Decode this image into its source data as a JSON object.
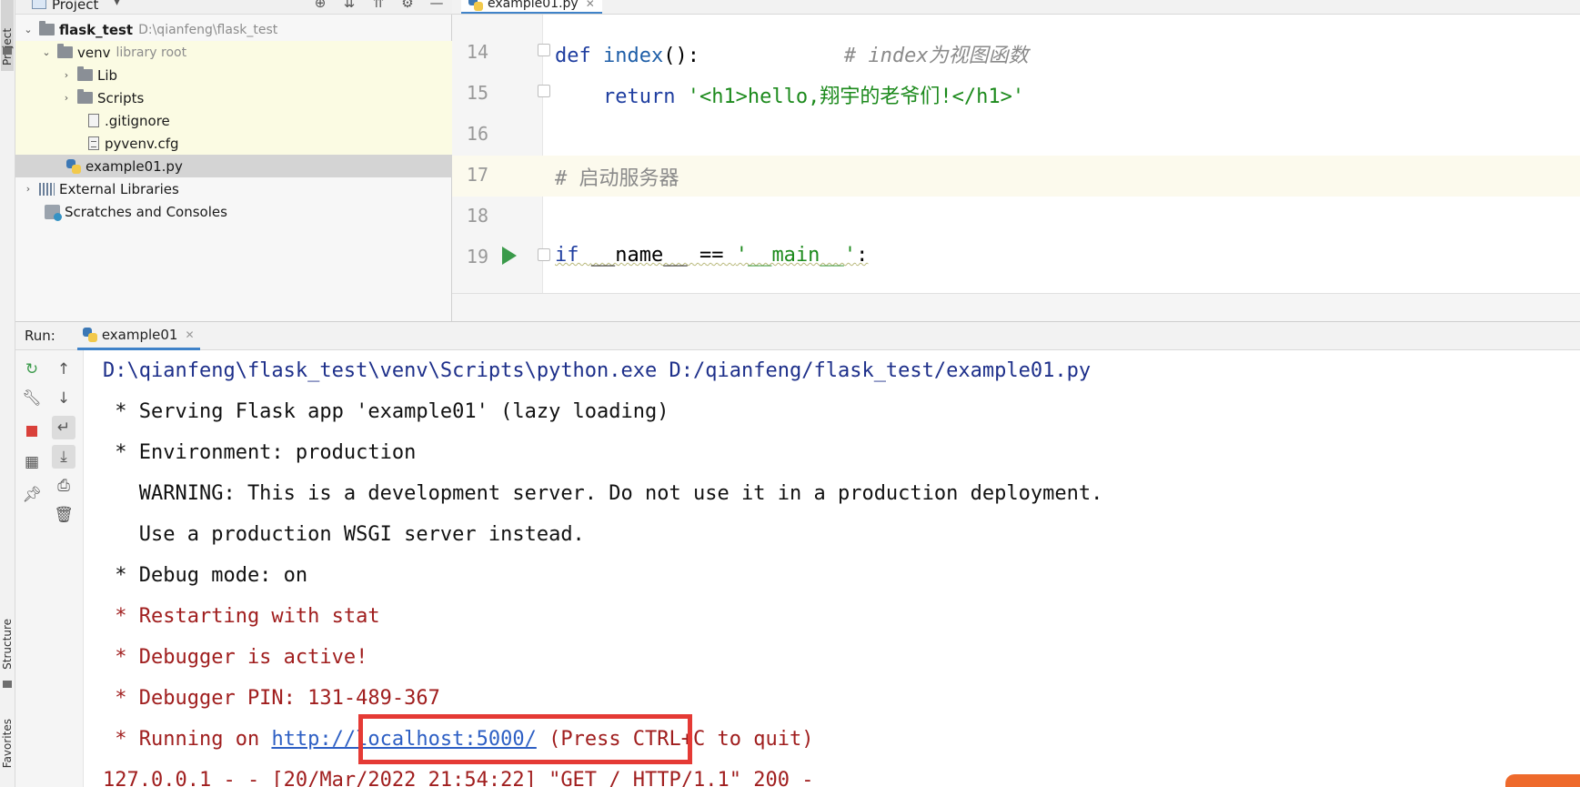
{
  "left_strip": {
    "project_tab": "Project",
    "structure_tab": "Structure",
    "favorites_tab": "Favorites"
  },
  "project": {
    "title": "Project",
    "tree": [
      {
        "label": "flask_test",
        "path": "D:\\qianfeng\\flask_test"
      },
      {
        "label": "venv",
        "note": "library root"
      },
      {
        "label": "Lib"
      },
      {
        "label": "Scripts"
      },
      {
        "label": ".gitignore"
      },
      {
        "label": "pyvenv.cfg"
      },
      {
        "label": "example01.py"
      },
      {
        "label": "External Libraries"
      },
      {
        "label": "Scratches and Consoles"
      }
    ]
  },
  "editor": {
    "tab": "example01.py",
    "lines": [
      {
        "no": "14",
        "kw": "def ",
        "fn": "index",
        "rest": "():",
        "comment": "# index为视图函数"
      },
      {
        "no": "15",
        "kw": "return ",
        "str": "'<h1>hello,翔宇的老爷们!</h1>'"
      },
      {
        "no": "16"
      },
      {
        "no": "17",
        "comment": "# 启动服务器"
      },
      {
        "no": "18"
      },
      {
        "no": "19",
        "kw": "if ",
        "mid": "__name__ == ",
        "str": "'__main__'",
        "end": ":"
      }
    ]
  },
  "run": {
    "label": "Run:",
    "tab": "example01",
    "console": {
      "cmd": "D:\\qianfeng\\flask_test\\venv\\Scripts\\python.exe D:/qianfeng/flask_test/example01.py",
      "l1": " * Serving Flask app 'example01' (lazy loading)",
      " l2": "",
      "l2": " * Environment: production",
      "l3": "   WARNING: This is a development server. Do not use it in a production deployment.",
      "l4": "   Use a production WSGI server instead.",
      "l5": " * Debug mode: on",
      "l6": " * Restarting with stat",
      "l7": " * Debugger is active!",
      "l8": " * Debugger PIN: 131-489-367",
      "l9_pre": " * Running on ",
      "l9_link": "http://localhost:5000/",
      "l9_post": " (Press CTRL+C to quit)",
      "l10": "127.0.0.1 - - [20/Mar/2022 21:54:22] \"GET / HTTP/1.1\" 200 -"
    }
  },
  "colors": {
    "accent": "#4083c9",
    "highlight_box": "#e53a35",
    "console_red": "#a01e1e",
    "console_blue": "#1d2f8a",
    "link": "#2d5fc4"
  }
}
